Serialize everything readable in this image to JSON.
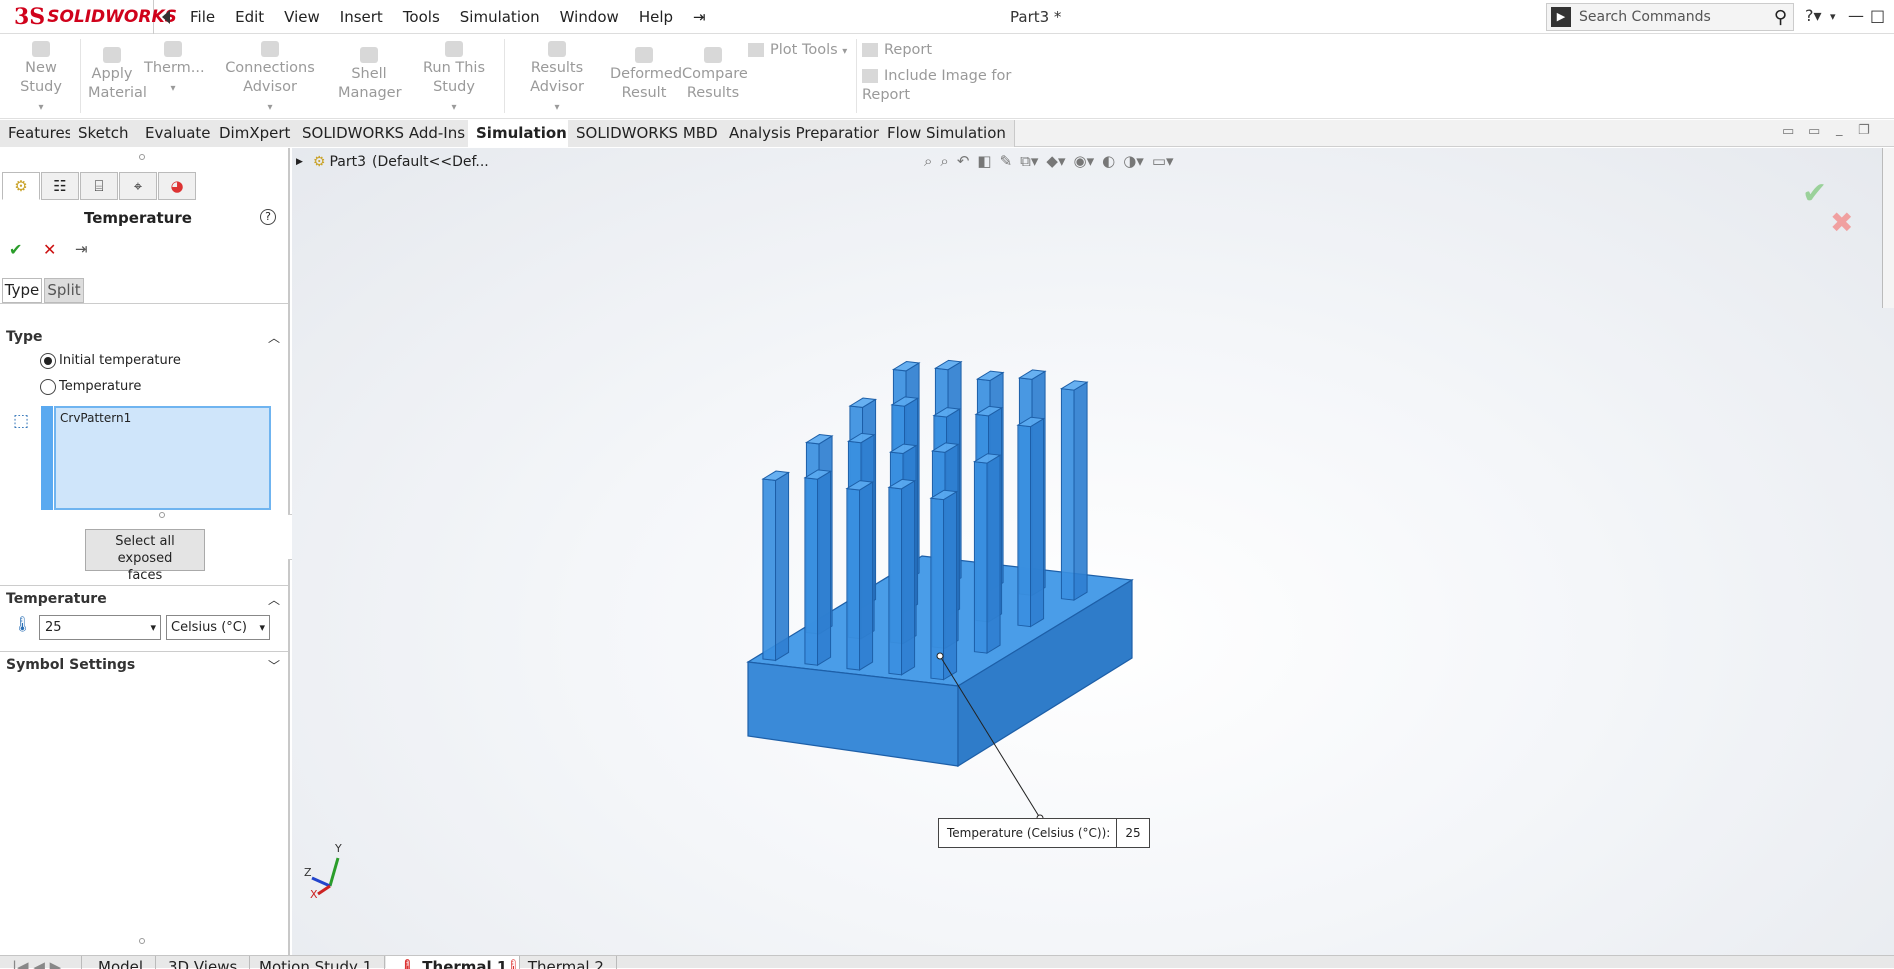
{
  "app": {
    "logo_ds": "3S",
    "logo_text": "SOLIDWORKS",
    "doc_title": "Part3 *"
  },
  "menu": [
    "File",
    "Edit",
    "View",
    "Insert",
    "Tools",
    "Simulation",
    "Window",
    "Help"
  ],
  "search": {
    "placeholder": "Search Commands"
  },
  "toolbar": {
    "new_study": "New Study",
    "apply_material_1": "Apply",
    "apply_material_2": "Material",
    "thermal": "Therm...",
    "connections": "Connections Advisor",
    "shell_1": "Shell",
    "shell_2": "Manager",
    "run_study": "Run This Study",
    "results_advisor": "Results Advisor",
    "deformed_1": "Deformed",
    "deformed_2": "Result",
    "compare_1": "Compare",
    "compare_2": "Results",
    "plot_tools": "Plot Tools",
    "report": "Report",
    "include_image": "Include Image for Report"
  },
  "tabs": [
    "Features",
    "Sketch",
    "Evaluate",
    "DimXpert",
    "SOLIDWORKS Add-Ins",
    "Simulation",
    "SOLIDWORKS MBD",
    "Analysis Preparation",
    "Flow Simulation"
  ],
  "active_tab": "Simulation",
  "panel": {
    "title": "Temperature",
    "subtabs": [
      "Type",
      "Split"
    ],
    "type_section": "Type",
    "radio_initial": "Initial temperature",
    "radio_temperature": "Temperature",
    "selection_item": "CrvPattern1",
    "select_all_1": "Select all exposed",
    "select_all_2": "faces",
    "temp_section": "Temperature",
    "temp_value": "25",
    "temp_unit": "Celsius (°C)",
    "symbol_section": "Symbol Settings"
  },
  "viewport": {
    "tree_label": "Part3",
    "tree_config": "(Default<<Def...",
    "callout_label": "Temperature (Celsius (°C)):",
    "callout_value": "25",
    "triad_y": "Y",
    "triad_z": "Z",
    "triad_x": "X"
  },
  "bottom_tabs": [
    "Model",
    "3D Views",
    "Motion Study 1",
    "Thermal 1",
    "Thermal 2"
  ],
  "active_bottom_tab": "Thermal 1",
  "colors": {
    "brand": "#d0021b",
    "part_blue": "#3a8fe0",
    "selection_blue": "#cfe5fa"
  }
}
